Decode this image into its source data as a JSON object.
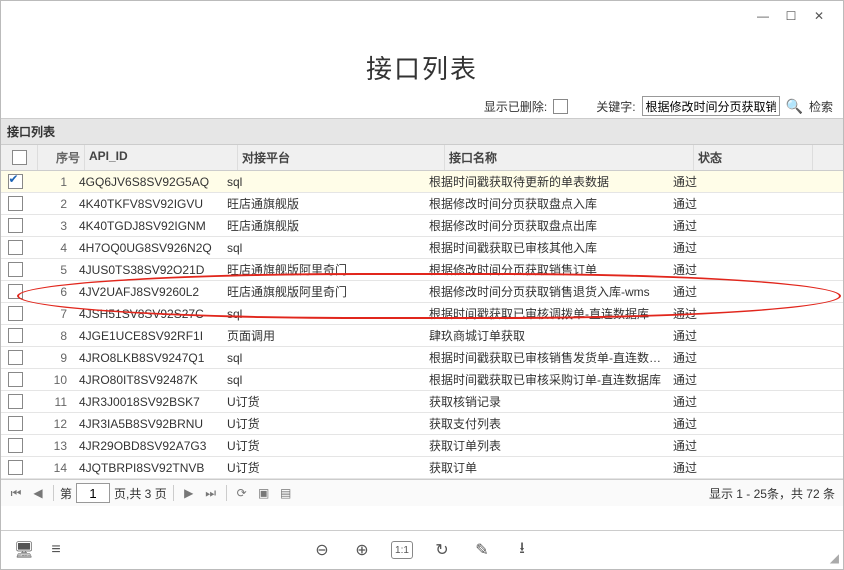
{
  "window": {
    "title": "接口列表",
    "panelTitle": "接口列表"
  },
  "filter": {
    "showDeletedLabel": "显示已删除:",
    "keywordLabel": "关键字:",
    "keywordValue": "根据修改时间分页获取销",
    "searchLabel": "检索"
  },
  "columns": {
    "seq": "序号",
    "api": "API_ID",
    "plat": "对接平台",
    "ifname": "接口名称",
    "status": "状态"
  },
  "rows": [
    {
      "seq": "1",
      "api": "4GQ6JV6S8SV92G5AQ",
      "plat": "sql",
      "ifname": "根据时间戳获取待更新的单表数据",
      "status": "通过",
      "checked": true
    },
    {
      "seq": "2",
      "api": "4K40TKFV8SV92IGVU",
      "plat": "旺店通旗舰版",
      "ifname": "根据修改时间分页获取盘点入库",
      "status": "通过",
      "checked": false
    },
    {
      "seq": "3",
      "api": "4K40TGDJ8SV92IGNM",
      "plat": "旺店通旗舰版",
      "ifname": "根据修改时间分页获取盘点出库",
      "status": "通过",
      "checked": false
    },
    {
      "seq": "4",
      "api": "4H7OQ0UG8SV926N2Q",
      "plat": "sql",
      "ifname": "根据时间戳获取已审核其他入库",
      "status": "通过",
      "checked": false
    },
    {
      "seq": "5",
      "api": "4JUS0TS38SV92O21D",
      "plat": "旺店通旗舰版阿里奇门",
      "ifname": "根据修改时间分页获取销售订单",
      "status": "通过",
      "checked": false
    },
    {
      "seq": "6",
      "api": "4JV2UAFJ8SV9260L2",
      "plat": "旺店通旗舰版阿里奇门",
      "ifname": "根据修改时间分页获取销售退货入库-wms",
      "status": "通过",
      "checked": false
    },
    {
      "seq": "7",
      "api": "4JSH51SV8SV92S27C",
      "plat": "sql",
      "ifname": "根据时间戳获取已审核调拨单-直连数据库",
      "status": "通过",
      "checked": false
    },
    {
      "seq": "8",
      "api": "4JGE1UCE8SV92RF1I",
      "plat": "页面调用",
      "ifname": "肆玖商城订单获取",
      "status": "通过",
      "checked": false
    },
    {
      "seq": "9",
      "api": "4JRO8LKB8SV9247Q1",
      "plat": "sql",
      "ifname": "根据时间戳获取已审核销售发货单-直连数据库",
      "status": "通过",
      "checked": false
    },
    {
      "seq": "10",
      "api": "4JRO80IT8SV92487K",
      "plat": "sql",
      "ifname": "根据时间戳获取已审核采购订单-直连数据库",
      "status": "通过",
      "checked": false
    },
    {
      "seq": "11",
      "api": "4JR3J0018SV92BSK7",
      "plat": "U订货",
      "ifname": "获取核销记录",
      "status": "通过",
      "checked": false
    },
    {
      "seq": "12",
      "api": "4JR3IA5B8SV92BRNU",
      "plat": "U订货",
      "ifname": "获取支付列表",
      "status": "通过",
      "checked": false
    },
    {
      "seq": "13",
      "api": "4JR29OBD8SV92A7G3",
      "plat": "U订货",
      "ifname": "获取订单列表",
      "status": "通过",
      "checked": false
    },
    {
      "seq": "14",
      "api": "4JQTBRPI8SV92TNVB",
      "plat": "U订货",
      "ifname": "获取订单",
      "status": "通过",
      "checked": false
    }
  ],
  "pager": {
    "pageLabelPrefix": "第",
    "pageValue": "1",
    "pageLabelSuffix": "页,共 3 页",
    "summary": "显示 1 - 25条，共 72 条"
  },
  "bottombar": {
    "ratio": "1:1"
  }
}
